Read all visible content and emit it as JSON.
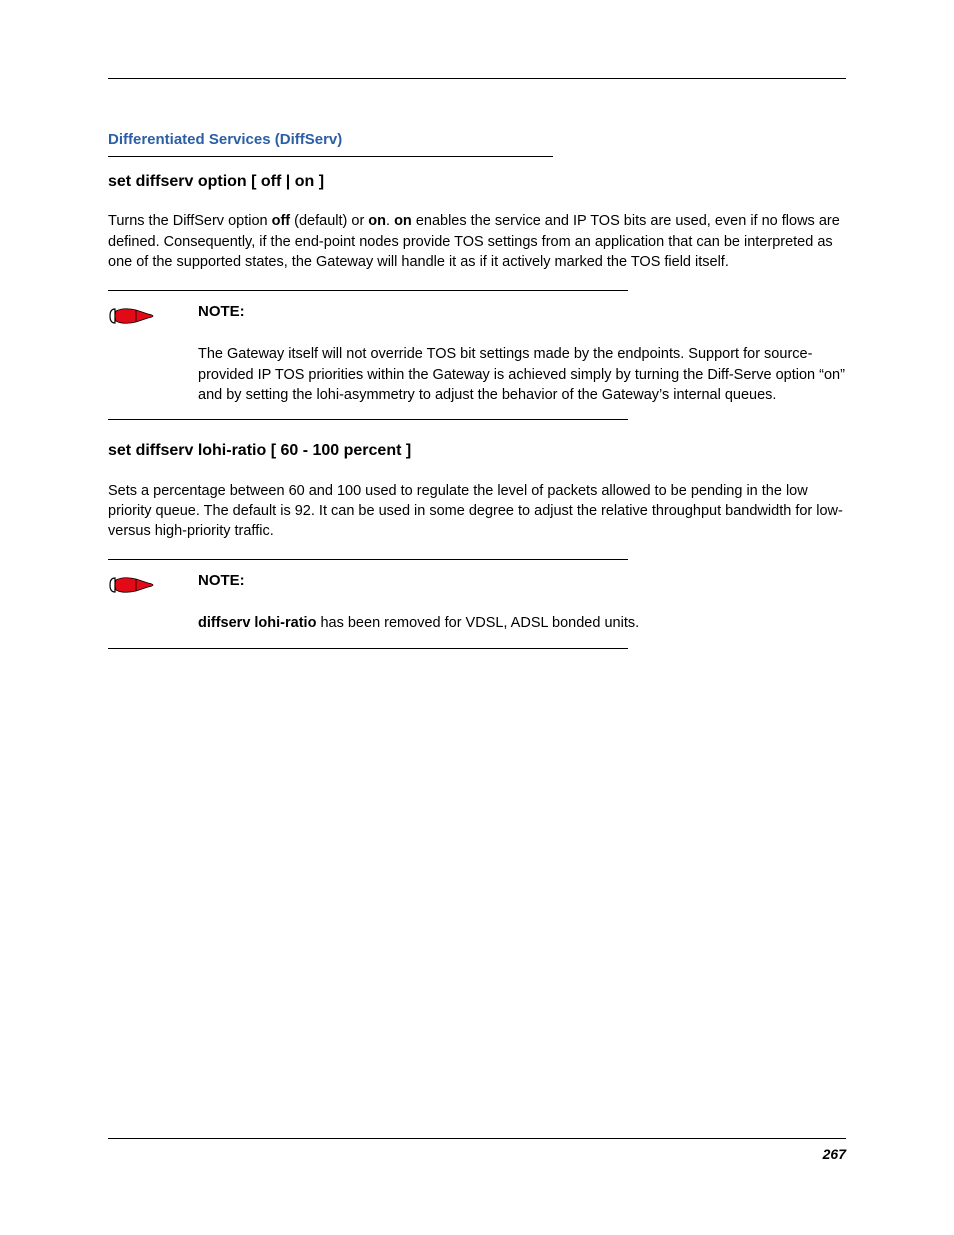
{
  "section_title": "Differentiated Services (DiffServ)",
  "cmd1": {
    "heading": "set diffserv option [ off | on ]",
    "para_parts": {
      "p1": "Turns the DiffServ option ",
      "b1": "off",
      "p2": " (default) or ",
      "b2": "on",
      "p3": ". ",
      "b3": "on",
      "p4": " enables the service and IP TOS bits are used, even if no flows are defined. Consequently, if the end-point nodes provide TOS settings from an application that can be interpreted as one of the supported states, the Gateway will handle it as if it actively marked the TOS field itself."
    },
    "note_label": "NOTE:",
    "note_text": "The Gateway itself will not override TOS bit settings made by the endpoints. Support for source-provided IP TOS priorities within the Gateway is achieved simply by turning the Diff-Serve option “on” and by setting the lohi-asymmetry to adjust the behavior of the Gateway’s internal queues."
  },
  "cmd2": {
    "heading": "set diffserv lohi-ratio [ 60 - 100 percent ]",
    "para": "Sets a percentage between 60 and 100 used to regulate the level of packets allowed to be pending in the low priority queue. The default is 92. It can be used in some degree to adjust the relative throughput bandwidth for low- versus high-priority traffic.",
    "note_label": "NOTE:",
    "note_bold": "diffserv lohi-ratio",
    "note_rest": " has been removed for VDSL, ADSL bonded units."
  },
  "page_number": "267"
}
